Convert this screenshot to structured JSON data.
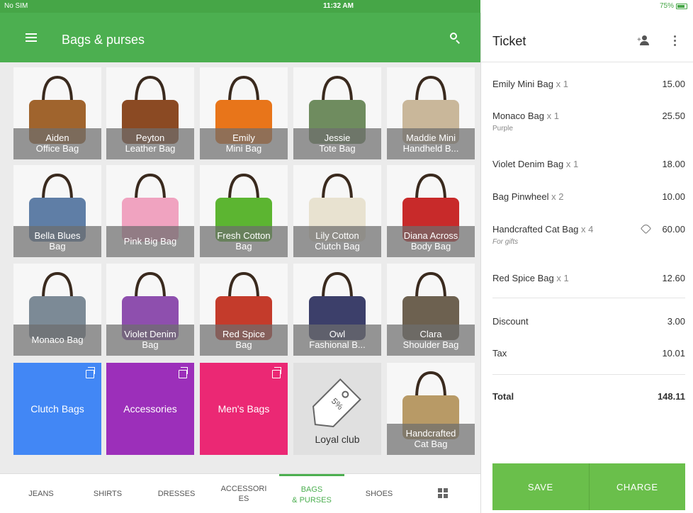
{
  "status_bar": {
    "carrier": "No SIM",
    "time": "11:32 AM",
    "battery": "75%"
  },
  "app_bar": {
    "title": "Bags & purses",
    "menu_icon": "hamburger-menu-icon",
    "search_icon": "search-icon"
  },
  "products": [
    {
      "name": "Aiden\nOffice Bag",
      "color": "#a0642d"
    },
    {
      "name": "Peyton\nLeather Bag",
      "color": "#8b4a23"
    },
    {
      "name": "Emily\nMini Bag",
      "color": "#e8751a"
    },
    {
      "name": "Jessie\nTote Bag",
      "color": "#6f8c5f"
    },
    {
      "name": "Maddie Mini\nHandheld B...",
      "color": "#c9b79a"
    },
    {
      "name": "Bella Blues\nBag",
      "color": "#5f7ea6"
    },
    {
      "name": "Pink Big Bag",
      "color": "#f0a3c0"
    },
    {
      "name": "Fresh Cotton\nBag",
      "color": "#5cb531"
    },
    {
      "name": "Lily Cotton\nClutch Bag",
      "color": "#e8e2d0"
    },
    {
      "name": "Diana Across\nBody Bag",
      "color": "#c82a2a"
    },
    {
      "name": "Monaco Bag",
      "color": "#7c8a96"
    },
    {
      "name": "Violet Denim\nBag",
      "color": "#8e4fae"
    },
    {
      "name": "Red Spice\nBag",
      "color": "#c43b2b"
    },
    {
      "name": "Owl\nFashional B...",
      "color": "#3c3f6a"
    },
    {
      "name": "Clara\nShoulder Bag",
      "color": "#6d6150"
    },
    {
      "name": "Handcrafted\nCat Bag",
      "color": "#b89a66"
    }
  ],
  "categories": [
    {
      "name": "Clutch Bags",
      "color": "#4287f5"
    },
    {
      "name": "Accessories",
      "color": "#9c2fba"
    },
    {
      "name": "Men's Bags",
      "color": "#eb2874"
    }
  ],
  "loyal": {
    "name": "Loyal club",
    "badge": "5%"
  },
  "tabs": [
    {
      "label": "JEANS"
    },
    {
      "label": "SHIRTS"
    },
    {
      "label": "DRESSES"
    },
    {
      "label": "ACCESSORI\nES"
    },
    {
      "label": "BAGS\n& PURSES"
    },
    {
      "label": "SHOES"
    }
  ],
  "tabs_grid_icon": "grid-view-icon",
  "ticket": {
    "title": "Ticket",
    "items": [
      {
        "name": "Emily Mini Bag",
        "qty": "x 1",
        "note": "",
        "price": "15.00"
      },
      {
        "name": "Monaco Bag",
        "qty": "x 1",
        "note": "Purple",
        "price": "25.50"
      },
      {
        "name": "Violet Denim Bag",
        "qty": "x 1",
        "note": "",
        "price": "18.00"
      },
      {
        "name": "Bag Pinwheel",
        "qty": "x 2",
        "note": "",
        "price": "10.00"
      },
      {
        "name": "Handcrafted Cat Bag",
        "qty": "x 4",
        "note": "For gifts",
        "price": "60.00"
      },
      {
        "name": "Red Spice Bag",
        "qty": "x 1",
        "note": "",
        "price": "12.60"
      }
    ],
    "discount_label": "Discount",
    "discount": "3.00",
    "tax_label": "Tax",
    "tax": "10.01",
    "total_label": "Total",
    "total": "148.11",
    "save_label": "SAVE",
    "charge_label": "CHARGE"
  },
  "colors": {
    "primary": "#4caf50",
    "button": "#6abf4b"
  }
}
